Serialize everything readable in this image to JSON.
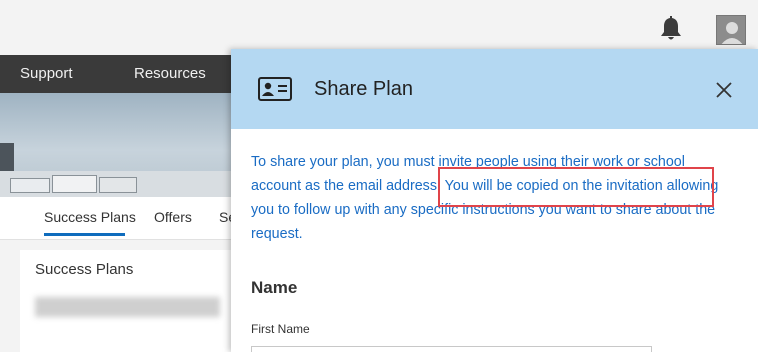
{
  "nav": {
    "items": [
      "Support",
      "Resources"
    ]
  },
  "tabs": {
    "items": [
      "Success Plans",
      "Offers",
      "Se"
    ]
  },
  "left_panel": {
    "title": "Success Plans"
  },
  "modal": {
    "title": "Share Plan",
    "description": "To share your plan, you must invite people using their work or school account as the email address. You will be copied on the invitation allowing you to follow up with any specific instructions you want to share about the request.",
    "section_title": "Name",
    "first_name_label": "First Name",
    "first_name_value": ""
  },
  "colors": {
    "header_bg": "#b4d8f2",
    "link_text": "#1a6cc4",
    "highlight_border": "#e0444a",
    "nav_bg": "#3a3a3a"
  },
  "icons": [
    "bell-icon",
    "avatar",
    "contact-card-icon",
    "close-icon"
  ]
}
